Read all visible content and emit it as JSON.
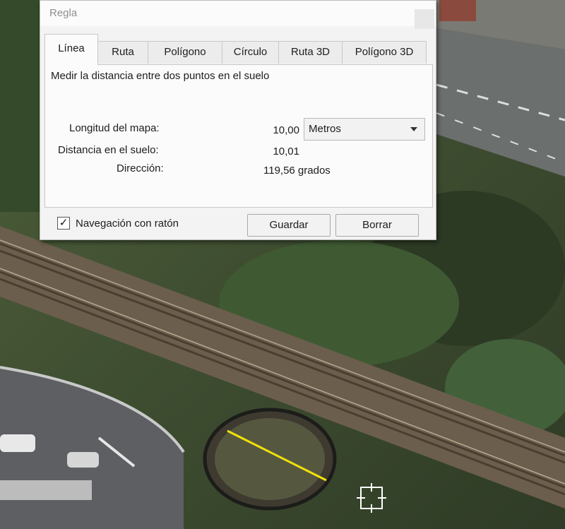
{
  "window": {
    "title": "Regla"
  },
  "tabs": [
    {
      "label": "Línea",
      "active": true
    },
    {
      "label": "Ruta",
      "active": false
    },
    {
      "label": "Polígono",
      "active": false
    },
    {
      "label": "Círculo",
      "active": false
    },
    {
      "label": "Ruta 3D",
      "active": false
    },
    {
      "label": "Polígono 3D",
      "active": false
    }
  ],
  "panel": {
    "description": "Medir la distancia entre dos puntos en el suelo",
    "map_length": {
      "label": "Longitud del mapa:",
      "value": "10,00"
    },
    "unit_select": {
      "value": "Metros"
    },
    "ground_distance": {
      "label": "Distancia en el suelo:",
      "value": "10,01"
    },
    "direction": {
      "label": "Dirección:",
      "value": "119,56 grados"
    }
  },
  "footer": {
    "mouse_nav": {
      "label": "Navegación con ratón",
      "checked": true,
      "check_glyph": "✓"
    },
    "save_label": "Guardar",
    "clear_label": "Borrar"
  },
  "colors": {
    "measure_line": "#f2e20a",
    "dialog_bg": "#f3f3f3"
  },
  "icons": {
    "cursor": "crosshair-cursor-icon"
  }
}
